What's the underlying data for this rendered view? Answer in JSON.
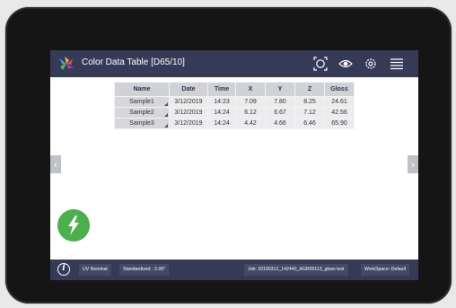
{
  "header": {
    "title": "Color Data Table [D65/10]",
    "icons": [
      "target-icon",
      "eye-icon",
      "gear-icon",
      "menu-icon"
    ]
  },
  "table": {
    "columns": [
      "Name",
      "Date",
      "Time",
      "X",
      "Y",
      "Z",
      "Gloss"
    ],
    "rows": [
      {
        "name": "Sample1",
        "date": "3/12/2019",
        "time": "14:23",
        "x": "7.09",
        "y": "7.80",
        "z": "8.25",
        "gloss": "24.61"
      },
      {
        "name": "Sample2",
        "date": "3/12/2019",
        "time": "14:24",
        "x": "6.12",
        "y": "6.67",
        "z": "7.12",
        "gloss": "42.56"
      },
      {
        "name": "Sample3",
        "date": "3/12/2019",
        "time": "14:24",
        "x": "4.42",
        "y": "4.66",
        "z": "6.46",
        "gloss": "65.90"
      }
    ]
  },
  "nav": {
    "left_arrow": "‹",
    "right_arrow": "›"
  },
  "footer": {
    "info_icon": "i",
    "uv": "UV Nominal",
    "standard": "Standardized - 2.00°",
    "job": "Job: 20190312_142440_AGR00113_gloss test",
    "workspace": "WorkSpace: Default"
  },
  "colors": {
    "bar": "#353b57",
    "measure_button": "#4cae4c",
    "header_cell": "#d0d2d8"
  }
}
